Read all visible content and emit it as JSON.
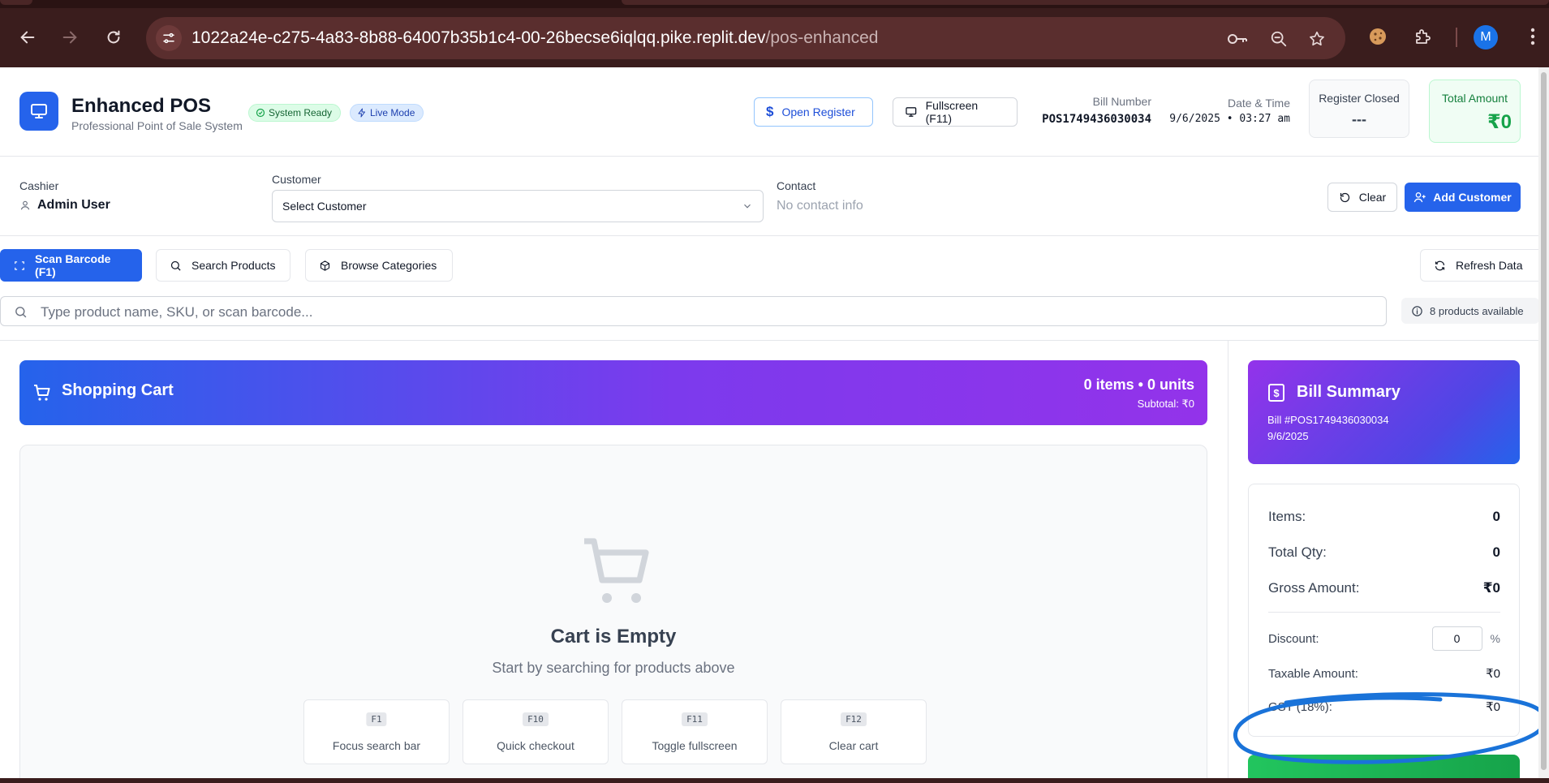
{
  "browser": {
    "url_host": "1022a24e-c275-4a83-8b88-64007b35b1c4-00-26becse6iqlqq.pike.replit.dev",
    "url_path": "/pos-enhanced",
    "profile_initial": "M"
  },
  "header": {
    "title": "Enhanced POS",
    "subtitle": "Professional Point of Sale System",
    "badge_status": "System Ready",
    "badge_mode": "Live Mode",
    "open_register_label": "Open Register",
    "fullscreen_label": "Fullscreen (F11)",
    "bill_number_label": "Bill Number",
    "bill_number": "POS1749436030034",
    "datetime_label": "Date & Time",
    "datetime": "9/6/2025 • 03:27 am",
    "register_label": "Register Closed",
    "register_value": "---",
    "total_label": "Total Amount",
    "total_value": "₹0"
  },
  "customer_row": {
    "cashier_label": "Cashier",
    "cashier_name": "Admin User",
    "customer_label": "Customer",
    "customer_select": "Select Customer",
    "contact_label": "Contact",
    "contact_value": "No contact info",
    "clear_label": "Clear",
    "add_customer_label": "Add Customer"
  },
  "toolbar": {
    "scan_label": "Scan Barcode (F1)",
    "search_label": "Search Products",
    "browse_label": "Browse Categories",
    "refresh_label": "Refresh Data",
    "search_placeholder": "Type product name, SKU, or scan barcode...",
    "products_available": "8 products available"
  },
  "cart": {
    "title": "Shopping Cart",
    "counts": "0 items • 0 units",
    "subtotal": "Subtotal: ₹0",
    "empty_title": "Cart is Empty",
    "empty_sub": "Start by searching for products above",
    "shortcuts": [
      {
        "key": "F1",
        "desc": "Focus search bar"
      },
      {
        "key": "F10",
        "desc": "Quick checkout"
      },
      {
        "key": "F11",
        "desc": "Toggle fullscreen"
      },
      {
        "key": "F12",
        "desc": "Clear cart"
      }
    ]
  },
  "bill": {
    "title": "Bill Summary",
    "number": "Bill #POS1749436030034",
    "date": "9/6/2025",
    "items_label": "Items:",
    "items_value": "0",
    "qty_label": "Total Qty:",
    "qty_value": "0",
    "gross_label": "Gross Amount:",
    "gross_value": "₹0",
    "discount_label": "Discount:",
    "discount_value": "0",
    "discount_unit": "%",
    "taxable_label": "Taxable Amount:",
    "taxable_value": "₹0",
    "gst_label": "GST (18%):",
    "gst_value": "₹0"
  },
  "colors": {
    "primary": "#2563eb",
    "annotation": "#1a73d9",
    "success": "#16a34a"
  }
}
